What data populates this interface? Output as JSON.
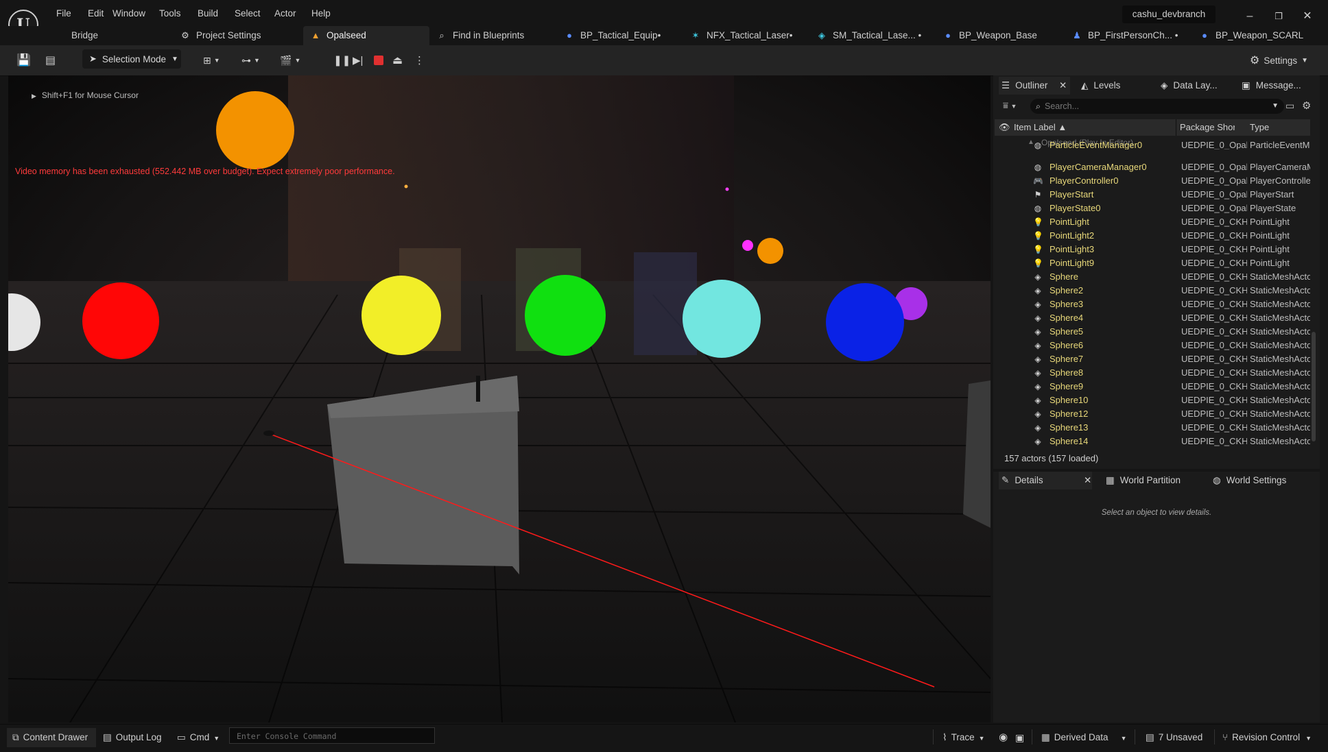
{
  "menu": [
    "File",
    "Edit",
    "Window",
    "Tools",
    "Build",
    "Select",
    "Actor",
    "Help"
  ],
  "branch": "cashu_devbranch",
  "window_controls": {
    "minimize": "–",
    "restore": "❐",
    "close": "✕"
  },
  "tabs": [
    {
      "label": "Bridge",
      "icon": "bridge-icon"
    },
    {
      "label": "Project Settings",
      "icon": "settings-gear-icon"
    },
    {
      "label": "Opalseed",
      "icon": "level-icon",
      "active": true
    },
    {
      "label": "Find in Blueprints",
      "icon": "find-icon"
    },
    {
      "label": "BP_Tactical_Equip•",
      "icon": "blueprint-icon"
    },
    {
      "label": "NFX_Tactical_Laser•",
      "icon": "niagara-icon"
    },
    {
      "label": "SM_Tactical_Lase... •",
      "icon": "static-mesh-icon"
    },
    {
      "label": "BP_Weapon_Base",
      "icon": "blueprint-icon"
    },
    {
      "label": "BP_FirstPersonCh... •",
      "icon": "character-icon"
    },
    {
      "label": "BP_Weapon_SCARL",
      "icon": "blueprint-icon"
    }
  ],
  "toolbar": {
    "selection_mode": "Selection Mode",
    "settings": "Settings"
  },
  "viewport": {
    "hint": "Shift+F1 for Mouse Cursor",
    "warning": "Video memory has been exhausted (552.442 MB over budget). Expect extremely poor performance."
  },
  "outliner": {
    "tabs": [
      "Outliner",
      "Levels",
      "Data Lay...",
      "Message..."
    ],
    "search_placeholder": "Search...",
    "columns": {
      "label": "Item Label ▲",
      "package": "Package Short N",
      "type": "Type"
    },
    "world_row": "Opalseed (Play In Editor)",
    "rows": [
      {
        "label": "ParticleEventManager0",
        "package": "UEDPIE_0_Opal",
        "type": "ParticleEventM",
        "icon": "actor-icon",
        "cut": true
      },
      {
        "label": "PlayerCameraManager0",
        "package": "UEDPIE_0_Opal",
        "type": "PlayerCameraM",
        "icon": "actor-icon"
      },
      {
        "label": "PlayerController0",
        "package": "UEDPIE_0_Opal",
        "type": "PlayerControlle",
        "icon": "gamepad-icon"
      },
      {
        "label": "PlayerStart",
        "package": "UEDPIE_0_Opal",
        "type": "PlayerStart",
        "icon": "player-start-icon"
      },
      {
        "label": "PlayerState0",
        "package": "UEDPIE_0_Opal",
        "type": "PlayerState",
        "icon": "actor-icon"
      },
      {
        "label": "PointLight",
        "package": "UEDPIE_0_CKH",
        "type": "PointLight",
        "icon": "point-light-icon"
      },
      {
        "label": "PointLight2",
        "package": "UEDPIE_0_CKH",
        "type": "PointLight",
        "icon": "point-light-icon"
      },
      {
        "label": "PointLight3",
        "package": "UEDPIE_0_CKH",
        "type": "PointLight",
        "icon": "point-light-icon"
      },
      {
        "label": "PointLight9",
        "package": "UEDPIE_0_CKH",
        "type": "PointLight",
        "icon": "point-light-icon"
      },
      {
        "label": "Sphere",
        "package": "UEDPIE_0_CKH",
        "type": "StaticMeshActo",
        "icon": "static-mesh-icon"
      },
      {
        "label": "Sphere2",
        "package": "UEDPIE_0_CKH",
        "type": "StaticMeshActo",
        "icon": "static-mesh-icon"
      },
      {
        "label": "Sphere3",
        "package": "UEDPIE_0_CKH",
        "type": "StaticMeshActo",
        "icon": "static-mesh-icon"
      },
      {
        "label": "Sphere4",
        "package": "UEDPIE_0_CKH",
        "type": "StaticMeshActo",
        "icon": "static-mesh-icon"
      },
      {
        "label": "Sphere5",
        "package": "UEDPIE_0_CKH",
        "type": "StaticMeshActo",
        "icon": "static-mesh-icon"
      },
      {
        "label": "Sphere6",
        "package": "UEDPIE_0_CKH",
        "type": "StaticMeshActo",
        "icon": "static-mesh-icon"
      },
      {
        "label": "Sphere7",
        "package": "UEDPIE_0_CKH",
        "type": "StaticMeshActo",
        "icon": "static-mesh-icon"
      },
      {
        "label": "Sphere8",
        "package": "UEDPIE_0_CKH",
        "type": "StaticMeshActo",
        "icon": "static-mesh-icon"
      },
      {
        "label": "Sphere9",
        "package": "UEDPIE_0_CKH",
        "type": "StaticMeshActo",
        "icon": "static-mesh-icon"
      },
      {
        "label": "Sphere10",
        "package": "UEDPIE_0_CKH",
        "type": "StaticMeshActo",
        "icon": "static-mesh-icon"
      },
      {
        "label": "Sphere12",
        "package": "UEDPIE_0_CKH",
        "type": "StaticMeshActo",
        "icon": "static-mesh-icon"
      },
      {
        "label": "Sphere13",
        "package": "UEDPIE_0_CKH",
        "type": "StaticMeshActo",
        "icon": "static-mesh-icon"
      },
      {
        "label": "Sphere14",
        "package": "UEDPIE_0_CKH",
        "type": "StaticMeshActo",
        "icon": "static-mesh-icon"
      }
    ],
    "actor_count": "157 actors (157 loaded)"
  },
  "details": {
    "tabs": [
      "Details",
      "World Partition",
      "World Settings"
    ],
    "empty_message": "Select an object to view details."
  },
  "statusbar": {
    "content_drawer": "Content Drawer",
    "output_log": "Output Log",
    "cmd": "Cmd",
    "console_placeholder": "Enter Console Command",
    "trace": "Trace",
    "derived_data": "Derived Data",
    "unsaved": "7 Unsaved",
    "revision_control": "Revision Control"
  },
  "colors": {
    "label_yellow": "#e8d87a",
    "warning_red": "#ff3b3b",
    "laser_red": "#ff1a1a",
    "panel_bg": "#1b1b1b"
  }
}
